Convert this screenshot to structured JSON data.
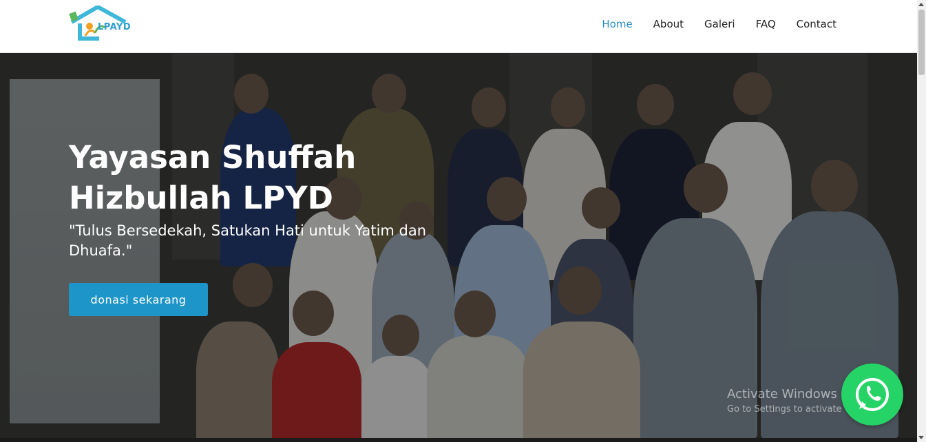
{
  "brand": {
    "logo_text": "LPAYD"
  },
  "nav": {
    "items": [
      "Home",
      "About",
      "Galeri",
      "FAQ",
      "Contact"
    ],
    "active": "Home"
  },
  "hero": {
    "title": "Yayasan Shuffah Hizbullah LPYD",
    "subtitle": "\"Tulus Bersedekah, Satukan Hati untuk Yatim dan Dhuafa.\"",
    "cta_label": "donasi sekarang"
  },
  "watermark": {
    "line1": "Activate Windows",
    "line2": "Go to Settings to activate Windows."
  },
  "icons": {
    "whatsapp": "whatsapp-icon"
  },
  "colors": {
    "accent": "#1e95c8",
    "nav_active": "#2a8cc8",
    "whatsapp": "#25d366"
  }
}
